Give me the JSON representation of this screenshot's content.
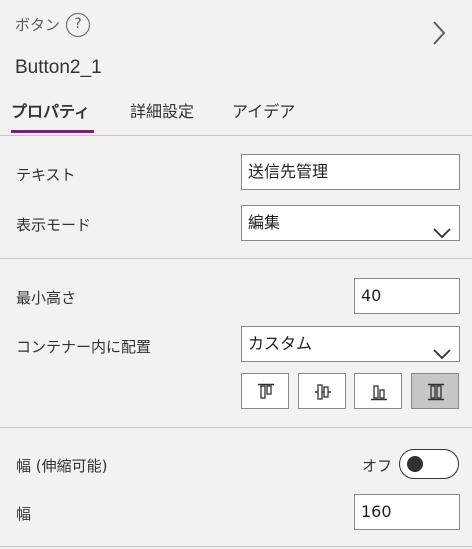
{
  "header": {
    "control_type": "ボタン",
    "help_glyph": "?",
    "control_name": "Button2_1"
  },
  "tabs": [
    {
      "label": "プロパティ",
      "active": true
    },
    {
      "label": "詳細設定",
      "active": false
    },
    {
      "label": "アイデア",
      "active": false
    }
  ],
  "properties": {
    "text": {
      "label": "テキスト",
      "value": "送信先管理"
    },
    "display_mode": {
      "label": "表示モード",
      "value": "編集"
    },
    "min_height": {
      "label": "最小高さ",
      "value": "40"
    },
    "align_in_container": {
      "label": "コンテナー内に配置",
      "value": "カスタム",
      "options": [
        {
          "icon": "align-top-icon",
          "selected": false
        },
        {
          "icon": "align-middle-icon",
          "selected": false
        },
        {
          "icon": "align-bottom-icon",
          "selected": false
        },
        {
          "icon": "align-stretch-icon",
          "selected": true
        }
      ]
    },
    "flexible_width": {
      "label": "幅 (伸縮可能)",
      "toggle_label": "オフ",
      "on": false
    },
    "width": {
      "label": "幅",
      "value": "160"
    }
  },
  "colors": {
    "accent": "#742774",
    "background": "#f3f2f1",
    "border": "#8a8886",
    "selected_button": "#c8c6c4"
  }
}
